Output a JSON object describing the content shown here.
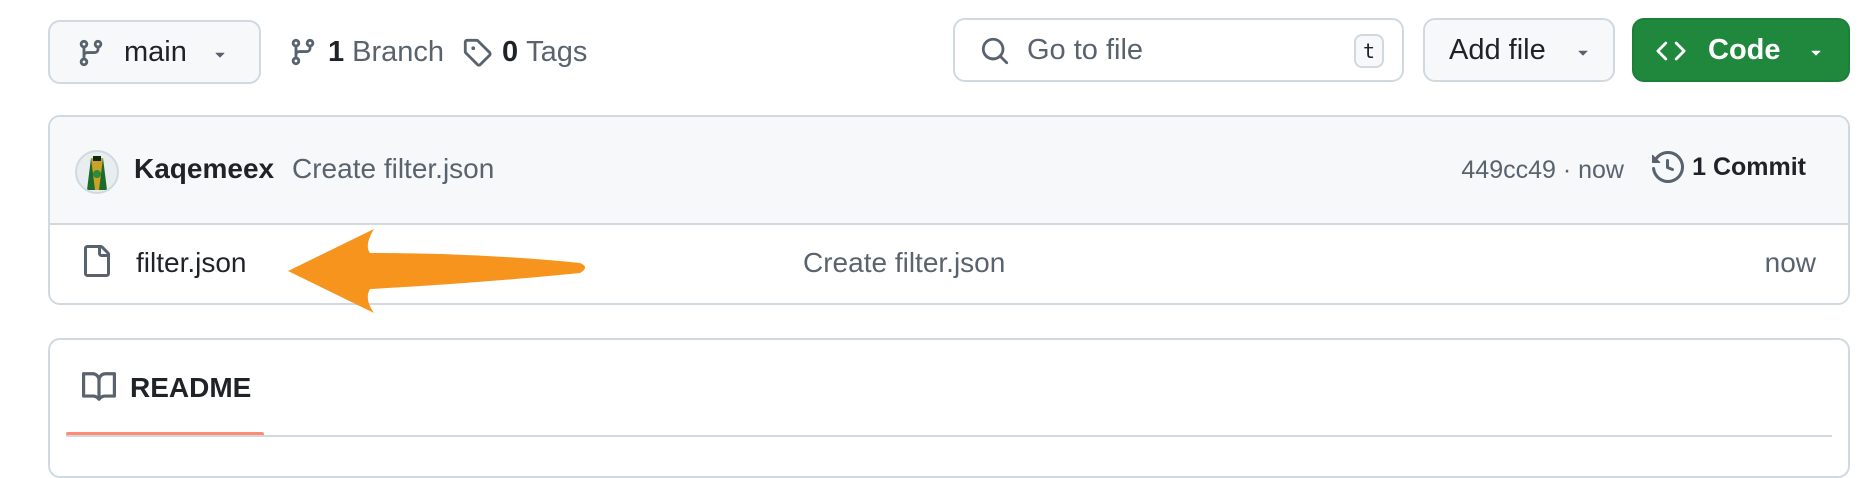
{
  "toolbar": {
    "branch_button": "main",
    "branch_count": "1",
    "branch_label": "Branch",
    "tag_count": "0",
    "tag_label": "Tags",
    "search_placeholder": "Go to file",
    "search_shortcut": "t",
    "add_file_label": "Add file",
    "code_label": "Code"
  },
  "commit_header": {
    "author": "Kaqemeex",
    "message": "Create filter.json",
    "hash_time": "449cc49 · now",
    "commits_label": "1 Commit"
  },
  "files": [
    {
      "name": "filter.json",
      "commit_message": "Create filter.json",
      "time": "now"
    }
  ],
  "readme": {
    "tab_label": "README"
  },
  "colors": {
    "accent_green": "#1f883d",
    "annotation_arrow": "#f7941d",
    "readme_underline": "#fd8c73"
  },
  "icons": [
    "git-branch-icon",
    "chevron-down-icon",
    "tag-icon",
    "search-icon",
    "code-icon",
    "history-icon",
    "file-icon",
    "book-icon",
    "avatar",
    "annotation-arrow"
  ]
}
